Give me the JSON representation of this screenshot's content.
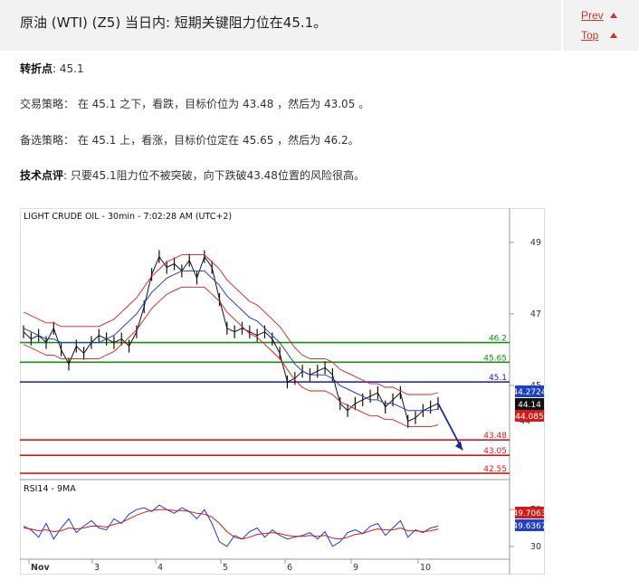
{
  "header": {
    "title": "原油 (WTI) (Z5) 当日内: 短期关键阻力位在45.1。",
    "prev_label": "Prev",
    "top_label": "Top"
  },
  "content": {
    "pivot_label": "转折点",
    "pivot_value": ": 45.1",
    "strategy_label": "交易策略",
    "strategy_text": "： 在 45.1 之下，看跌，目标价位为 43.48 ，然后为 43.05 。",
    "alt_label": "备选策略",
    "alt_text": "： 在 45.1 上，看涨，目标价位定在 45.65 ，然后为 46.2。",
    "comment_label": "技术点评",
    "comment_text": ": 只要45.1阻力位不被突破，向下跌破43.48位置的风险很高。"
  },
  "chart_data": [
    {
      "type": "line",
      "title": "LIGHT CRUDE OIL - 30min - 7:02:28 AM (UTC+2)",
      "ylim": [
        42.5,
        49.5
      ],
      "y_ticks": [
        49,
        47,
        45
      ],
      "y_tick_labels": [
        "49",
        "47",
        "45"
      ],
      "extra_tick": {
        "value": 44,
        "label": "44"
      },
      "x_tick_labels": [
        "Nov",
        "3",
        "4",
        "5",
        "6",
        "9",
        "10"
      ],
      "series": [
        {
          "values": [
            46.5,
            46.3,
            46.4,
            46.2,
            46.6,
            46.0,
            45.6,
            46.1,
            45.9,
            46.2,
            46.4,
            46.3,
            46.2,
            46.3,
            46.1,
            46.5,
            47.2,
            48.1,
            48.6,
            48.3,
            48.4,
            48.2,
            48.5,
            48.0,
            48.6,
            48.3,
            47.4,
            46.6,
            46.5,
            46.6,
            46.5,
            46.4,
            46.5,
            46.3,
            45.9,
            45.1,
            45.2,
            45.4,
            45.3,
            45.4,
            45.5,
            45.3,
            44.5,
            44.3,
            44.5,
            44.6,
            44.7,
            44.8,
            44.4,
            44.6,
            44.8,
            44.0,
            44.1,
            44.3,
            44.4,
            44.5
          ]
        },
        {
          "values": [
            46.6,
            46.5,
            46.4,
            46.3,
            46.3,
            46.2,
            46.2,
            46.2,
            46.2,
            46.2,
            46.2,
            46.3,
            46.4,
            46.6,
            46.8,
            47.0,
            47.3,
            47.6,
            47.8,
            48.0,
            48.1,
            48.2,
            48.2,
            48.2,
            48.2,
            48.0,
            47.8,
            47.5,
            47.3,
            47.1,
            46.9,
            46.8,
            46.6,
            46.4,
            46.2,
            45.9,
            45.6,
            45.4,
            45.3,
            45.3,
            45.3,
            45.2,
            45.0,
            44.9,
            44.8,
            44.7,
            44.6,
            44.6,
            44.5,
            44.5,
            44.4,
            44.3,
            44.3,
            44.3,
            44.3,
            44.35
          ]
        }
      ],
      "levels": [
        {
          "value": 46.2,
          "label": "46.2",
          "color": "#1a8a1a"
        },
        {
          "value": 45.65,
          "label": "45.65",
          "color": "#1a8a1a"
        },
        {
          "value": 45.1,
          "label": "45.1",
          "color": "#1a1aa6"
        },
        {
          "value": 43.48,
          "label": "43.48",
          "color": "#d11a1a"
        },
        {
          "value": 43.05,
          "label": "43.05",
          "color": "#d11a1a"
        },
        {
          "value": 42.55,
          "label": "42.55",
          "color": "#d11a1a"
        }
      ],
      "price_tags": [
        {
          "label": "44.2724",
          "color": "#1f3fc4"
        },
        {
          "label": "44.14",
          "color": "#111111"
        },
        {
          "label": "44.085",
          "color": "#d11a1a"
        }
      ]
    },
    {
      "type": "line",
      "title": "RSI14 - 9MA",
      "ylim": [
        20,
        85
      ],
      "y_ticks": [
        70,
        30
      ],
      "y_tick_labels": [
        "70",
        "30"
      ],
      "series": [
        {
          "values": [
            52,
            48,
            40,
            55,
            38,
            50,
            60,
            45,
            52,
            58,
            50,
            48,
            60,
            55,
            65,
            70,
            72,
            68,
            75,
            70,
            66,
            72,
            68,
            60,
            70,
            55,
            35,
            30,
            42,
            38,
            46,
            50,
            40,
            48,
            42,
            38,
            40,
            42,
            45,
            38,
            46,
            30,
            35,
            45,
            48,
            44,
            52,
            55,
            42,
            50,
            58,
            40,
            48,
            45,
            50,
            52
          ]
        },
        {
          "values": [
            50,
            49,
            47,
            48,
            46,
            47,
            50,
            49,
            50,
            52,
            52,
            51,
            54,
            56,
            60,
            64,
            67,
            69,
            70,
            70,
            69,
            69,
            68,
            66,
            65,
            62,
            55,
            46,
            40,
            38,
            40,
            43,
            44,
            45,
            44,
            42,
            41,
            41,
            42,
            41,
            42,
            39,
            38,
            40,
            43,
            44,
            47,
            49,
            48,
            48,
            50,
            47,
            47,
            46,
            47,
            49
          ]
        }
      ],
      "price_tags": [
        {
          "label": "49.7063",
          "color": "#d11a1a"
        },
        {
          "label": "49.6367",
          "color": "#1f3fc4"
        }
      ]
    }
  ]
}
